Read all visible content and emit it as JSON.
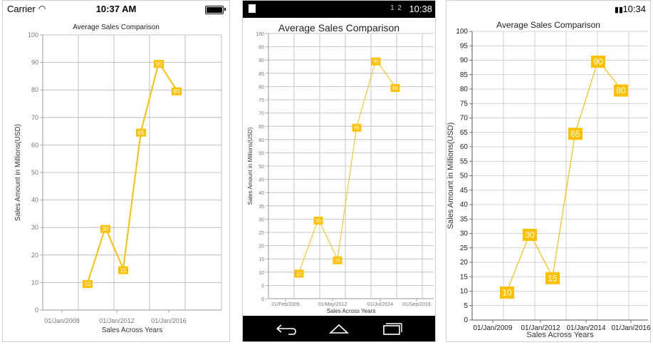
{
  "ios": {
    "status": {
      "carrier": "Carrier",
      "time": "10:37 AM"
    },
    "chart_title": "Average Sales Comparison",
    "xlabel": "Sales Across Years",
    "ylabel": "Sales Amount in Millions(USD)",
    "x_ticks": [
      "01/Jan/2008",
      "01/Jan/2012",
      "01/Jan/2016"
    ]
  },
  "android": {
    "status": {
      "time": "10:38",
      "icons": "1  2"
    },
    "chart_title": "Average Sales Comparison",
    "xlabel": "Sales Across Years",
    "ylabel": "Sales Amount in Millions(USD)",
    "x_ticks": [
      "01/Feb/2009",
      "01/May/2012",
      "01/Jul/2014",
      "01/Sep/2016"
    ]
  },
  "windows": {
    "status": {
      "time": "10:34"
    },
    "chart_title": "Average Sales Comparison",
    "xlabel": "Sales Across Years",
    "ylabel": "Sales Amount in Millions(USD)",
    "x_ticks": [
      "01/Jan/2009",
      "01/Jan/2012",
      "01/Jan/2014",
      "01/Jan/2016"
    ]
  },
  "chart_data": [
    {
      "platform": "ios",
      "type": "line",
      "title": "Average Sales Comparison",
      "xlabel": "Sales Across Years",
      "ylabel": "Sales Amount in Millions(USD)",
      "ylim": [
        0,
        100
      ],
      "y_step": 10,
      "x_ticks": [
        "01/Jan/2008",
        "01/Jan/2012",
        "01/Jan/2016"
      ],
      "x": [
        "2010-01",
        "2011-01",
        "2012-01",
        "2013-01",
        "2014-01",
        "2015-01"
      ],
      "values": [
        10,
        30,
        15,
        65,
        90,
        80
      ],
      "series_color": "#FFC000",
      "grid": true
    },
    {
      "platform": "android",
      "type": "line",
      "title": "Average Sales Comparison",
      "xlabel": "Sales Across Years",
      "ylabel": "Sales Amount in Millions(USD)",
      "ylim": [
        0,
        100
      ],
      "y_step": 5,
      "x_ticks": [
        "01/Feb/2009",
        "01/May/2012",
        "01/Jul/2014",
        "01/Sep/2016"
      ],
      "x": [
        "2010-01",
        "2011-01",
        "2012-01",
        "2013-01",
        "2014-01",
        "2015-01"
      ],
      "values": [
        10,
        30,
        15,
        65,
        90,
        80
      ],
      "series_color": "#FFC000",
      "grid": true
    },
    {
      "platform": "windows",
      "type": "line",
      "title": "Average Sales Comparison",
      "xlabel": "Sales Across Years",
      "ylabel": "Sales Amount in Millions(USD)",
      "ylim": [
        0,
        100
      ],
      "y_step": 5,
      "x_ticks": [
        "01/Jan/2009",
        "01/Jan/2012",
        "01/Jan/2014",
        "01/Jan/2016"
      ],
      "x": [
        "2010-01",
        "2011-01",
        "2012-01",
        "2013-01",
        "2014-01",
        "2015-01"
      ],
      "values": [
        10,
        30,
        15,
        65,
        90,
        80
      ],
      "series_color": "#FFC000",
      "grid": true
    }
  ]
}
